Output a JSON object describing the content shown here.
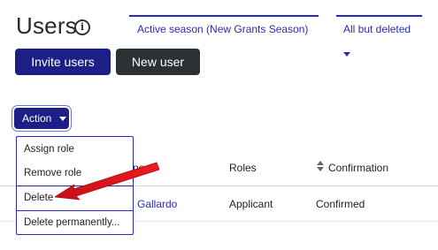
{
  "header": {
    "title": "Users",
    "info_icon": "info-icon"
  },
  "filters": {
    "season": "Active season (New Grants Season)",
    "status": "All but deleted"
  },
  "buttons": {
    "invite": "Invite users",
    "new_user": "New user",
    "action": "Action"
  },
  "action_menu": {
    "items": [
      "Assign role",
      "Remove role",
      "Delete",
      "Delete permanently..."
    ]
  },
  "table": {
    "headers": {
      "name": "ne",
      "roles": "Roles",
      "confirmation": "Confirmation"
    },
    "rows": [
      {
        "name": "Gallardo",
        "role": "Applicant",
        "confirmation": "Confirmed"
      }
    ]
  },
  "colors": {
    "primary": "#1b1f86",
    "link": "#2a2ab8",
    "dark_button": "#2b3135",
    "annotation_arrow": "#e0121b"
  }
}
